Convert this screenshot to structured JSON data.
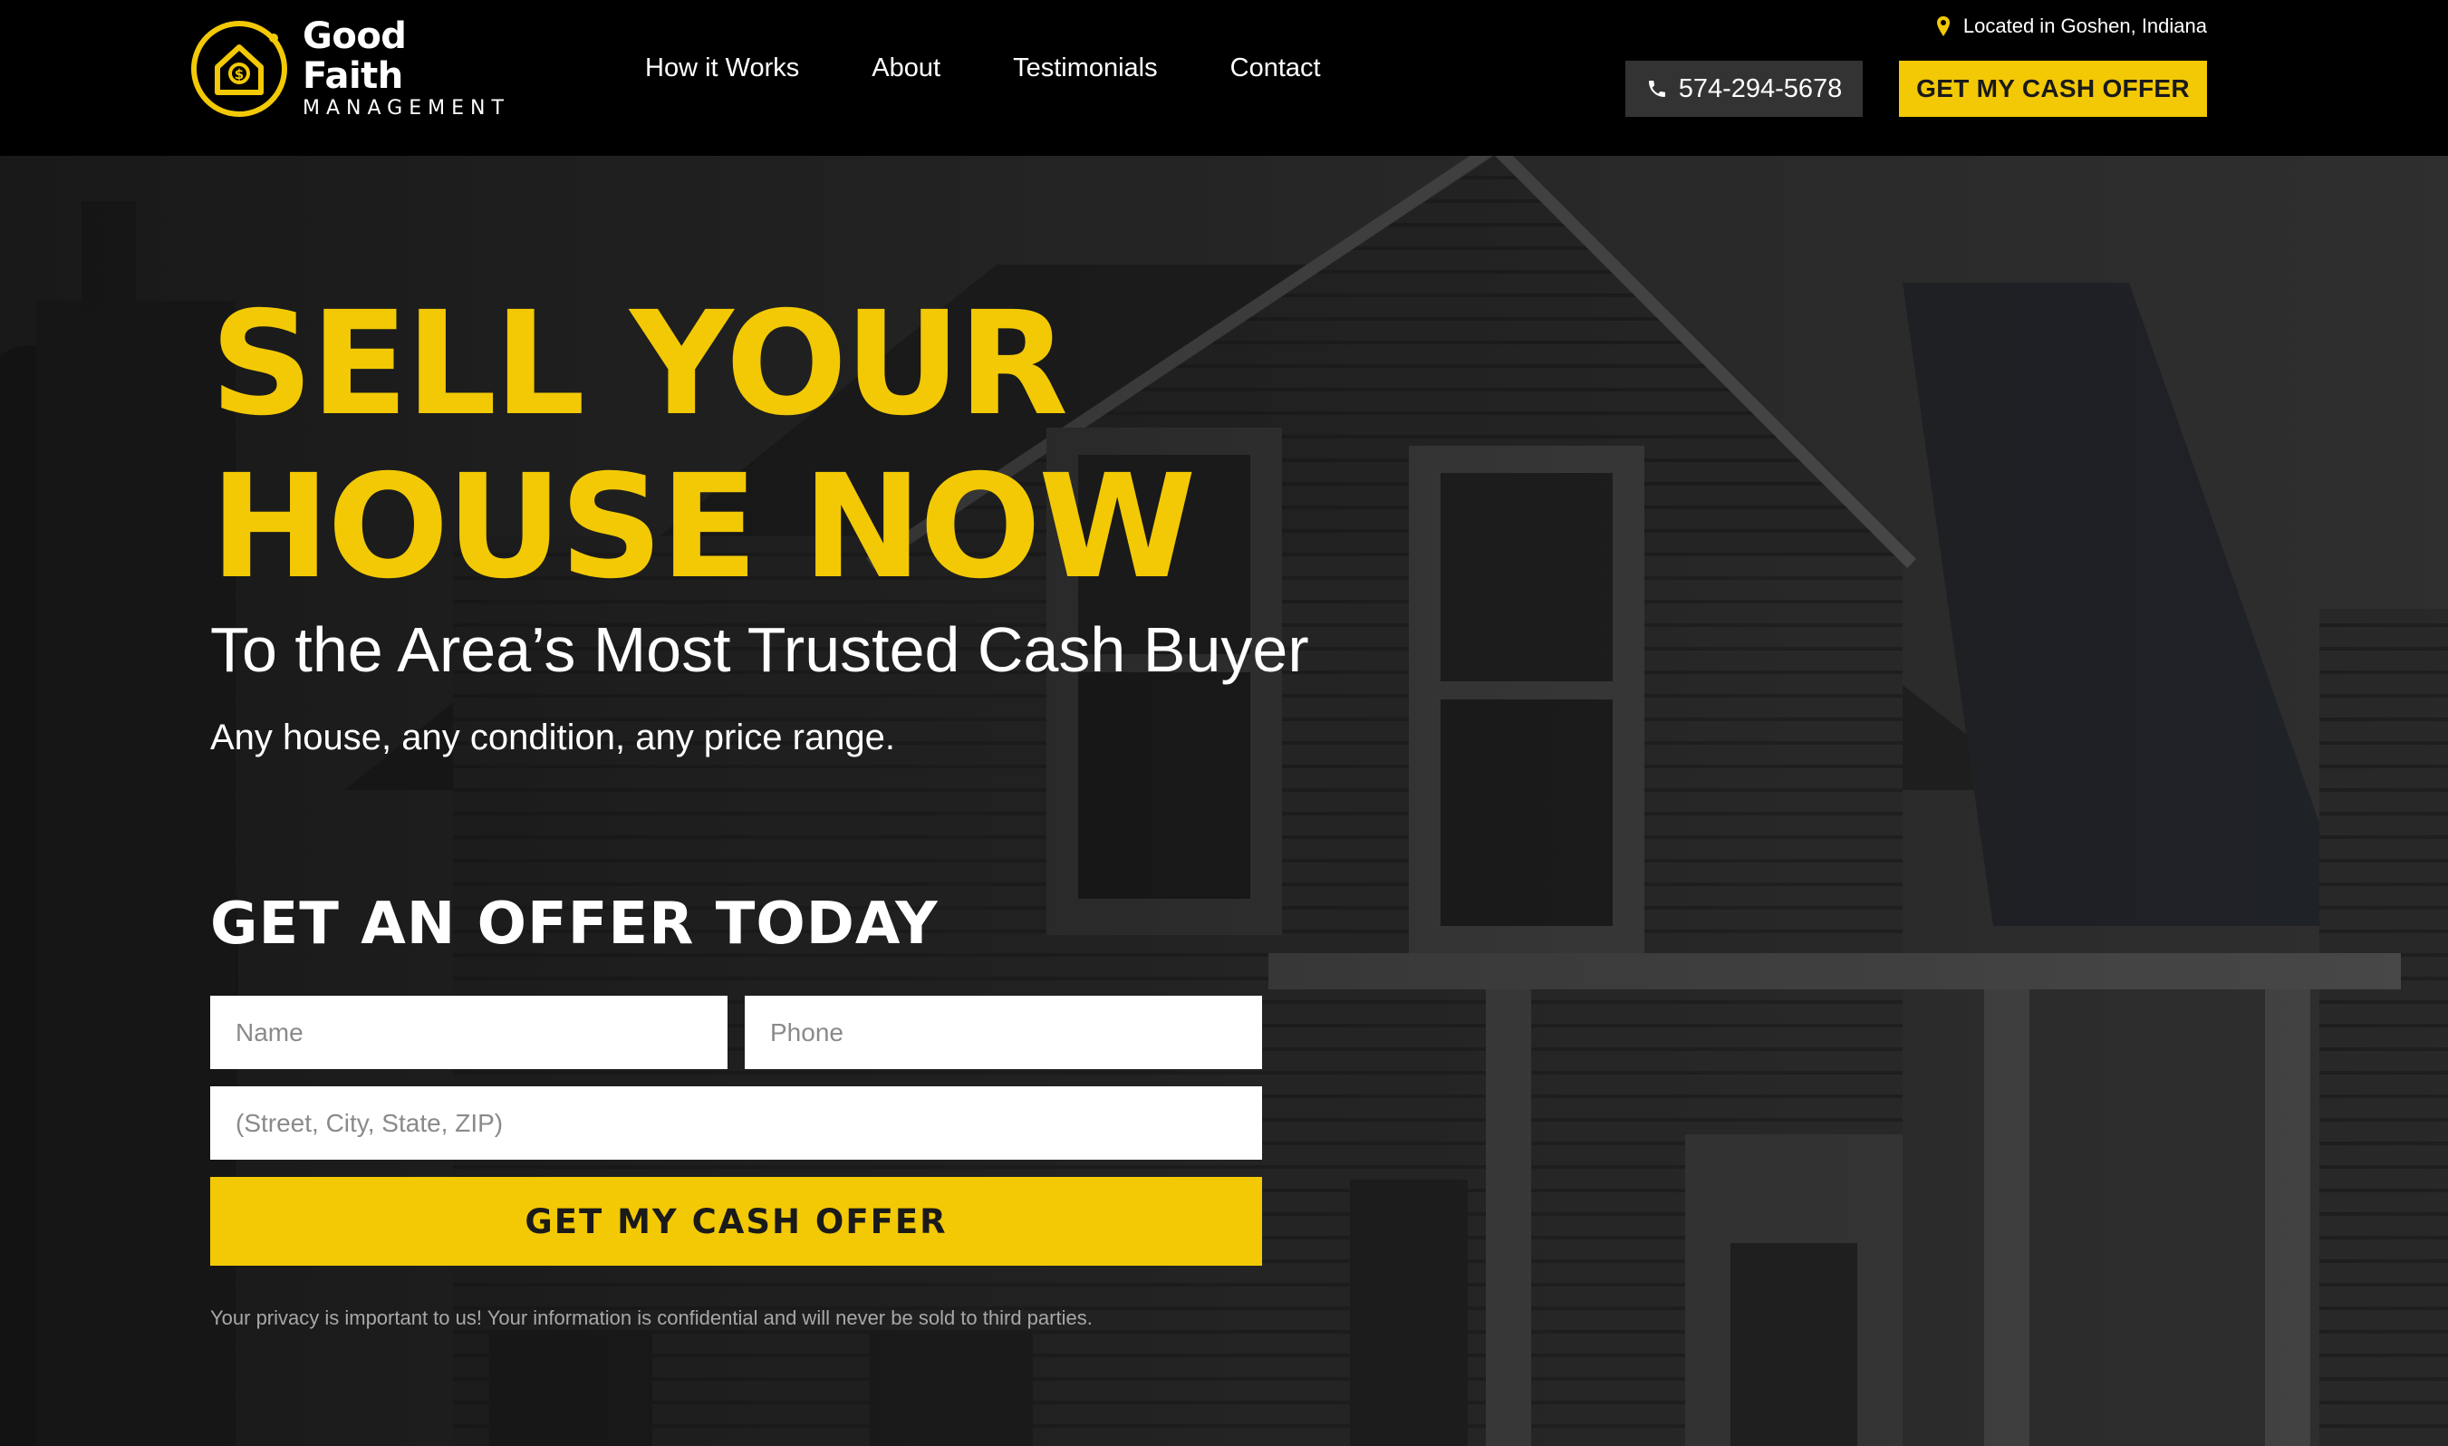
{
  "colors": {
    "accent": "#f2c904",
    "header_bg": "#000000",
    "phone_button_bg": "#333333",
    "hero_overlay": "#1f1f1f"
  },
  "brand": {
    "name": "Good Faith",
    "sub": "MANAGEMENT",
    "logo_icon": "house-dollar-icon"
  },
  "nav": {
    "items": [
      {
        "label": "How it Works"
      },
      {
        "label": "About"
      },
      {
        "label": "Testimonials"
      },
      {
        "label": "Contact"
      }
    ]
  },
  "header": {
    "location_icon": "map-pin-icon",
    "location": "Located in Goshen, Indiana",
    "phone_icon": "phone-icon",
    "phone": "574-294-5678",
    "cta_label": "GET MY CASH OFFER"
  },
  "hero": {
    "headline_line1": "SELL YOUR",
    "headline_line2": "HOUSE NOW",
    "subheadline": "To the Area’s Most Trusted Cash Buyer",
    "tagline": "Any house, any condition, any price range."
  },
  "form": {
    "title": "GET AN OFFER TODAY",
    "name_placeholder": "Name",
    "phone_placeholder": "Phone",
    "address_placeholder": "(Street, City, State, ZIP)",
    "name_value": "",
    "phone_value": "",
    "address_value": "",
    "submit_label": "GET MY CASH OFFER",
    "privacy": "Your privacy is important to us! Your information is confidential and will never be sold to third parties."
  }
}
